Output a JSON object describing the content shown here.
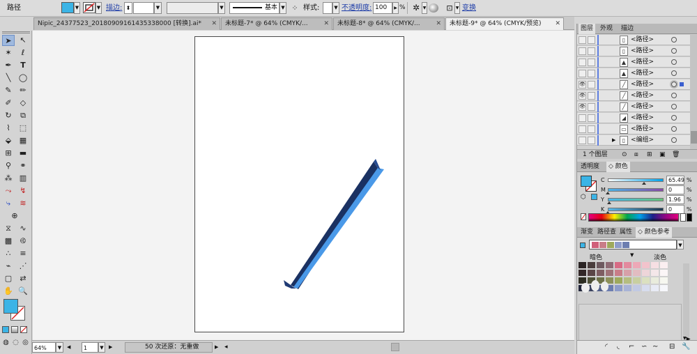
{
  "control_bar": {
    "selection_type": "路径",
    "stroke_label": "描边:",
    "stroke_profile": "基本",
    "style_label": "样式:",
    "opacity_label": "不透明度:",
    "opacity_value": "100",
    "opacity_unit": "%",
    "transform_label": "变换",
    "fill_color": "#3bb4e6"
  },
  "tabs": [
    {
      "label": "Nipic_24377523_20180909161435338000 [转换].ai*",
      "close": "✕"
    },
    {
      "label": "未标题-7* @ 64% (CMYK/...",
      "close": "✕"
    },
    {
      "label": "未标题-8* @ 64% (CMYK/...",
      "close": "✕"
    },
    {
      "label": "未标题-9* @ 64% (CMYK/预览)",
      "close": "✕"
    }
  ],
  "status_bar": {
    "zoom": "64%",
    "artboard_number": "1",
    "undo_text": "50 次还原：无重做"
  },
  "layers_panel": {
    "tabs": [
      "图层",
      "外观",
      "描边"
    ],
    "rows": [
      {
        "name": "<路径>",
        "visible": false,
        "selected": false
      },
      {
        "name": "<路径>",
        "visible": false,
        "selected": false
      },
      {
        "name": "<路径>",
        "visible": false,
        "selected": false
      },
      {
        "name": "<路径>",
        "visible": false,
        "selected": false
      },
      {
        "name": "<路径>",
        "visible": true,
        "selected": true
      },
      {
        "name": "<路径>",
        "visible": true,
        "selected": false
      },
      {
        "name": "<路径>",
        "visible": true,
        "selected": false
      },
      {
        "name": "<路径>",
        "visible": false,
        "selected": false
      },
      {
        "name": "<路径>",
        "visible": false,
        "selected": false
      },
      {
        "name": "<编组>",
        "visible": false,
        "selected": false
      }
    ],
    "footer_count": "1 个图层"
  },
  "color_panel": {
    "tabs": [
      "透明度",
      "颜色"
    ],
    "channels": [
      {
        "label": "C",
        "value": "65.49",
        "unit": "%",
        "level": 0.6549,
        "gradient": "linear-gradient(to right,#fff,#00a0e9)"
      },
      {
        "label": "M",
        "value": "0",
        "unit": "%",
        "level": 0,
        "gradient": "linear-gradient(to right,#49b6e8,#8a4aa8)"
      },
      {
        "label": "Y",
        "value": "1.96",
        "unit": "%",
        "level": 0.0196,
        "gradient": "linear-gradient(to right,#4ab6ea,#64c47a)"
      },
      {
        "label": "K",
        "value": "0",
        "unit": "%",
        "level": 0,
        "gradient": "linear-gradient(to right,#5ab8e8,#1d3950)"
      }
    ],
    "fill_color": "#3bb4e6"
  },
  "guide_panel": {
    "tabs": [
      "渐变",
      "路径查",
      "属性",
      "颜色参考"
    ],
    "dark_label": "暗色",
    "light_label": "淡色"
  }
}
